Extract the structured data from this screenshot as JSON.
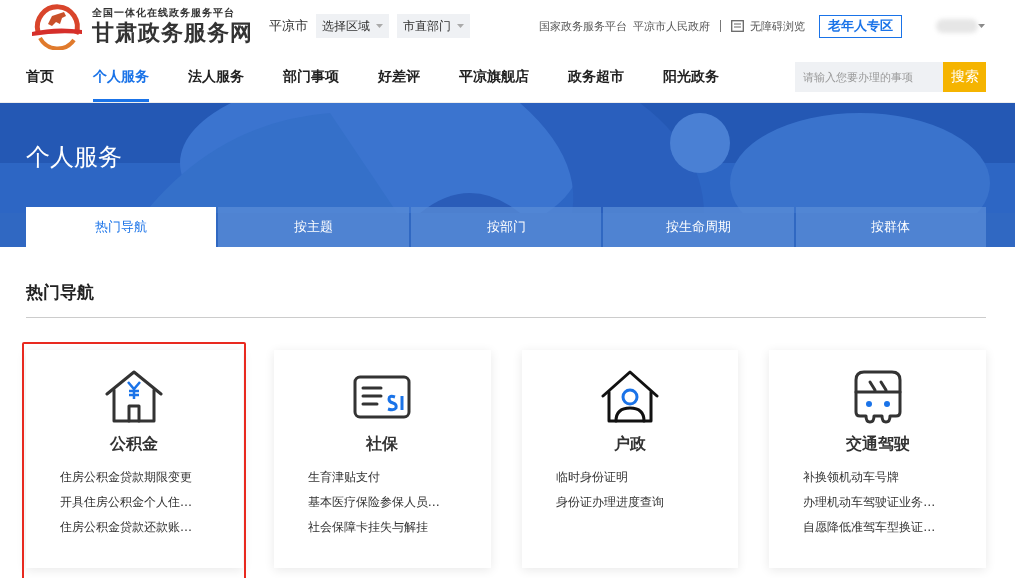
{
  "header": {
    "platform_tagline": "全国一体化在线政务服务平台",
    "site_name": "甘肃政务服务网",
    "city": "平凉市",
    "selectors": [
      {
        "label": "选择区域"
      },
      {
        "label": "市直部门"
      }
    ],
    "links": [
      "国家政务服务平台",
      "平凉市人民政府"
    ],
    "accessibility_link": "无障碍浏览",
    "elderly_button": "老年人专区"
  },
  "nav": {
    "items": [
      {
        "label": "首页",
        "selected": false
      },
      {
        "label": "个人服务",
        "selected": true
      },
      {
        "label": "法人服务",
        "selected": false
      },
      {
        "label": "部门事项",
        "selected": false
      },
      {
        "label": "好差评",
        "selected": false
      },
      {
        "label": "平凉旗舰店",
        "selected": false
      },
      {
        "label": "政务超市",
        "selected": false
      },
      {
        "label": "阳光政务",
        "selected": false
      }
    ],
    "search": {
      "placeholder": "请输入您要办理的事项",
      "button": "搜索"
    }
  },
  "banner": {
    "title": "个人服务",
    "tabs": [
      {
        "label": "热门导航",
        "selected": true
      },
      {
        "label": "按主题",
        "selected": false
      },
      {
        "label": "按部门",
        "selected": false
      },
      {
        "label": "按生命周期",
        "selected": false
      },
      {
        "label": "按群体",
        "selected": false
      }
    ]
  },
  "section": {
    "title": "热门导航",
    "cards": [
      {
        "kind": "fund",
        "title": "公积金",
        "highlighted": true,
        "items": [
          "住房公积金贷款期限变更",
          "开具住房公积金个人住…",
          "住房公积金贷款还款账…"
        ]
      },
      {
        "kind": "insurance",
        "title": "社保",
        "highlighted": false,
        "items": [
          "生育津贴支付",
          "基本医疗保险参保人员…",
          "社会保障卡挂失与解挂"
        ]
      },
      {
        "kind": "household",
        "title": "户政",
        "highlighted": false,
        "items": [
          "临时身份证明",
          "身份证办理进度查询"
        ]
      },
      {
        "kind": "traffic",
        "title": "交通驾驶",
        "highlighted": false,
        "items": [
          "补换领机动车号牌",
          "办理机动车驾驶证业务…",
          "自愿降低准驾车型换证…"
        ]
      }
    ]
  }
}
